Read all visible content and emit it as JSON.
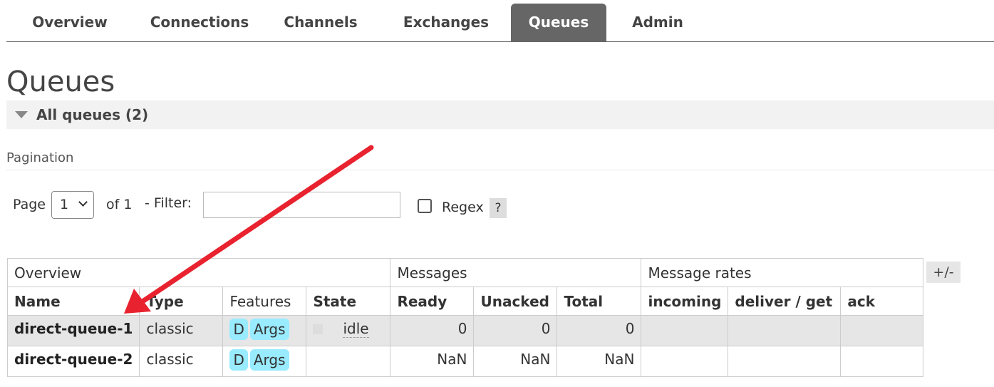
{
  "nav": {
    "tabs": [
      {
        "label": "Overview"
      },
      {
        "label": "Connections"
      },
      {
        "label": "Channels"
      },
      {
        "label": "Exchanges"
      },
      {
        "label": "Queues"
      },
      {
        "label": "Admin"
      }
    ],
    "active": "Queues"
  },
  "page": {
    "title": "Queues"
  },
  "section": {
    "label": "All queues (2)"
  },
  "pagination": {
    "title": "Pagination",
    "page_label": "Page",
    "page_value": "1",
    "of_label": "of 1",
    "filter_label": "- Filter:",
    "filter_value": "",
    "regex_label": "Regex",
    "help_label": "?"
  },
  "table": {
    "toggle_label": "+/-",
    "groups": [
      "Overview",
      "Messages",
      "Message rates"
    ],
    "columns": [
      "Name",
      "Type",
      "Features",
      "State",
      "Ready",
      "Unacked",
      "Total",
      "incoming",
      "deliver / get",
      "ack"
    ],
    "rows": [
      {
        "name": "direct-queue-1",
        "type": "classic",
        "features": [
          "D",
          "Args"
        ],
        "state": "idle",
        "ready": "0",
        "unacked": "0",
        "total": "0",
        "incoming": "",
        "deliver_get": "",
        "ack": ""
      },
      {
        "name": "direct-queue-2",
        "type": "classic",
        "features": [
          "D",
          "Args"
        ],
        "state": "",
        "ready": "NaN",
        "unacked": "NaN",
        "total": "NaN",
        "incoming": "",
        "deliver_get": "",
        "ack": ""
      }
    ]
  },
  "colors": {
    "active_tab": "#666666",
    "badge": "#99ebff",
    "annotation_arrow": "#e8232f"
  }
}
